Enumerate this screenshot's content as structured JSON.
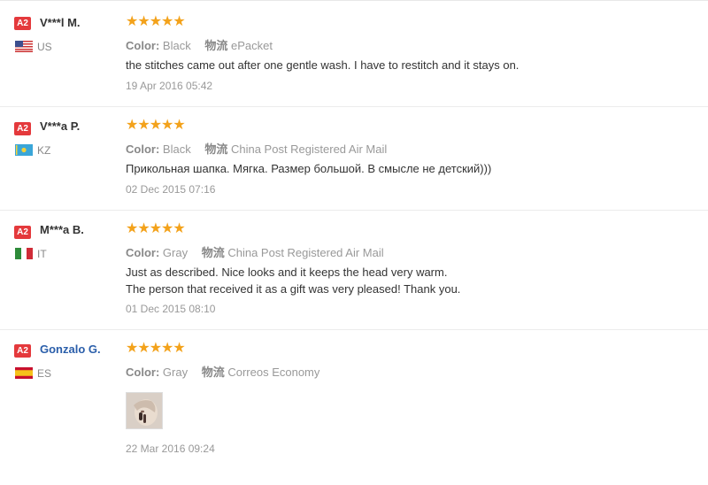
{
  "reviews": [
    {
      "badge": "A2",
      "name": "V***l M.",
      "country": "US",
      "color_label": "Color:",
      "color_value": "Black",
      "shipping_label": "物流",
      "shipping_value": "ePacket",
      "lines": [
        "the stitches came out after one gentle wash. I have to restitch and it stays on."
      ],
      "date": "19 Apr 2016 05:42"
    },
    {
      "badge": "A2",
      "name": "V***a P.",
      "country": "KZ",
      "color_label": "Color:",
      "color_value": "Black",
      "shipping_label": "物流",
      "shipping_value": "China Post Registered Air Mail",
      "lines": [
        "Прикольная шапка. Мягка. Размер большой. В смысле не детский)))"
      ],
      "date": "02 Dec 2015 07:16"
    },
    {
      "badge": "A2",
      "name": "M***a B.",
      "country": "IT",
      "color_label": "Color:",
      "color_value": "Gray",
      "shipping_label": "物流",
      "shipping_value": "China Post Registered Air Mail",
      "lines": [
        "Just as described. Nice looks and it keeps the head very warm.",
        "The person that received it as a gift was very pleased! Thank you."
      ],
      "date": "01 Dec 2015 08:10"
    },
    {
      "badge": "A2",
      "name": "Gonzalo G.",
      "country": "ES",
      "color_label": "Color:",
      "color_value": "Gray",
      "shipping_label": "物流",
      "shipping_value": "Correos Economy",
      "lines": [],
      "date": "22 Mar 2016 09:24"
    }
  ],
  "stars": "★★★★★",
  "colors": {
    "star": "#f3a21b",
    "badge": "#e4393c",
    "link": "#2a5eaa"
  }
}
